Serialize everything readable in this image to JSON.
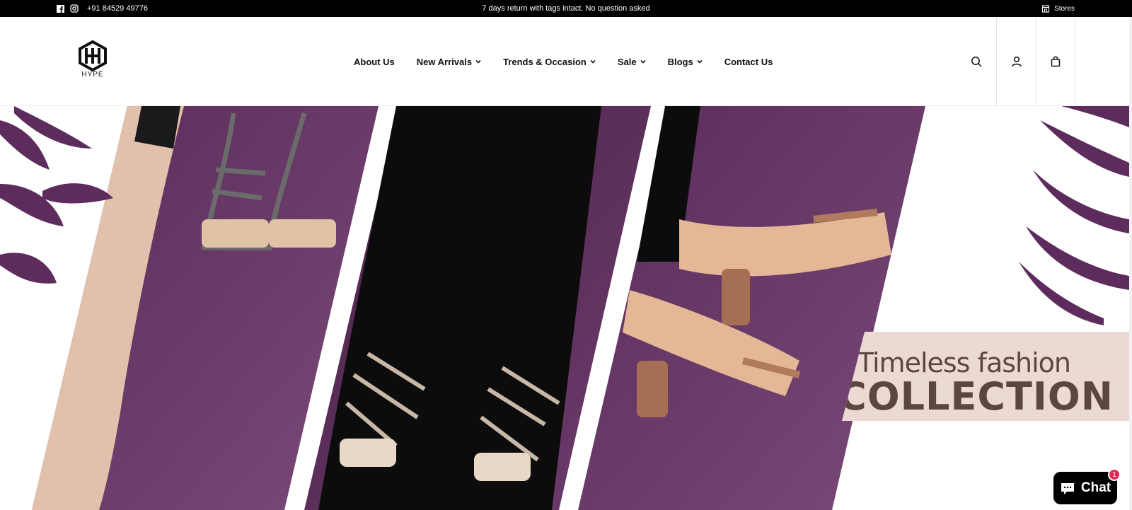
{
  "announcement": {
    "phone": "+91 84529 49776",
    "message": "7 days return with tags intact. No question asked",
    "stores_label": "Stores",
    "social_icons": [
      "facebook-icon",
      "instagram-icon"
    ]
  },
  "header": {
    "logo_text": "HYPE",
    "nav": [
      {
        "label": "About Us",
        "has_dropdown": false
      },
      {
        "label": "New Arrivals",
        "has_dropdown": true
      },
      {
        "label": "Trends & Occasion",
        "has_dropdown": true
      },
      {
        "label": "Sale",
        "has_dropdown": true
      },
      {
        "label": "Blogs",
        "has_dropdown": true
      },
      {
        "label": "Contact Us",
        "has_dropdown": false
      }
    ],
    "icons": [
      "search-icon",
      "account-icon",
      "cart-icon"
    ]
  },
  "hero": {
    "banner_line1": "Timeless fashion",
    "banner_line2": "COLLECTION"
  },
  "chat": {
    "label": "Chat",
    "badge": "1"
  },
  "colors": {
    "topbar": "#000000",
    "purple": "#5e2c5c",
    "banner_bg": "#ecd9d4",
    "banner_text": "#5c4640",
    "badge": "#e32b55"
  }
}
